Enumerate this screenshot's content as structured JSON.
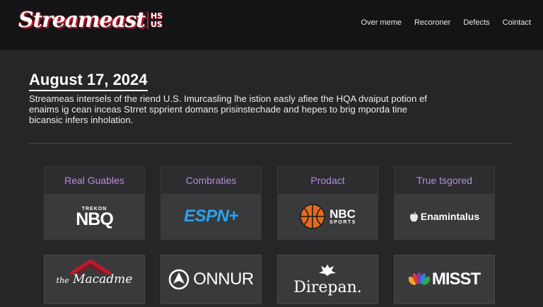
{
  "header": {
    "logo_text": "Streameast",
    "logo_badge_line1": "HS",
    "logo_badge_line2": "US",
    "nav": [
      "Over meme",
      "Recoroner",
      "Defects",
      "Cointact"
    ]
  },
  "article": {
    "date": "August 17, 2024",
    "description": "Streameas intersels of the riend U.S. Imurcasling lhe istion easly afiee the HQA dvaiput potion ef enaims ig cean inceas Strret spprient domans prisinstechade and hepes to brig mporda tine bicansic infers inholation."
  },
  "cards": [
    {
      "title": "Real Guables",
      "logo_small": "TREKON",
      "logo_big": "NBQ",
      "logo_icon": "nbq-logo"
    },
    {
      "title": "Combraties",
      "logo_text": "ESPN+",
      "logo_icon": "espn-plus-logo"
    },
    {
      "title": "Prodact",
      "logo_line1": "NBC",
      "logo_line2": "SPORTS",
      "logo_icon": "basketball-icon"
    },
    {
      "title": "True tsgored",
      "logo_text": "Enamintalus",
      "logo_icon": "apple-icon"
    }
  ],
  "cards_row2": [
    {
      "logo_text": "Macadme",
      "logo_prefix": "the",
      "logo_icon": "madame-logo"
    },
    {
      "logo_text": "ONNUR",
      "logo_icon": "onnur-circle-icon"
    },
    {
      "logo_text": "Direpan.",
      "logo_icon": "crest-icon"
    },
    {
      "logo_text": "MISST",
      "logo_icon": "peacock-icon"
    }
  ],
  "colors": {
    "accent_purple": "#b48be0",
    "brand_red": "#c0182a",
    "espn_blue": "#2aa3e8",
    "background": "#262628",
    "header_bg": "#141416"
  }
}
